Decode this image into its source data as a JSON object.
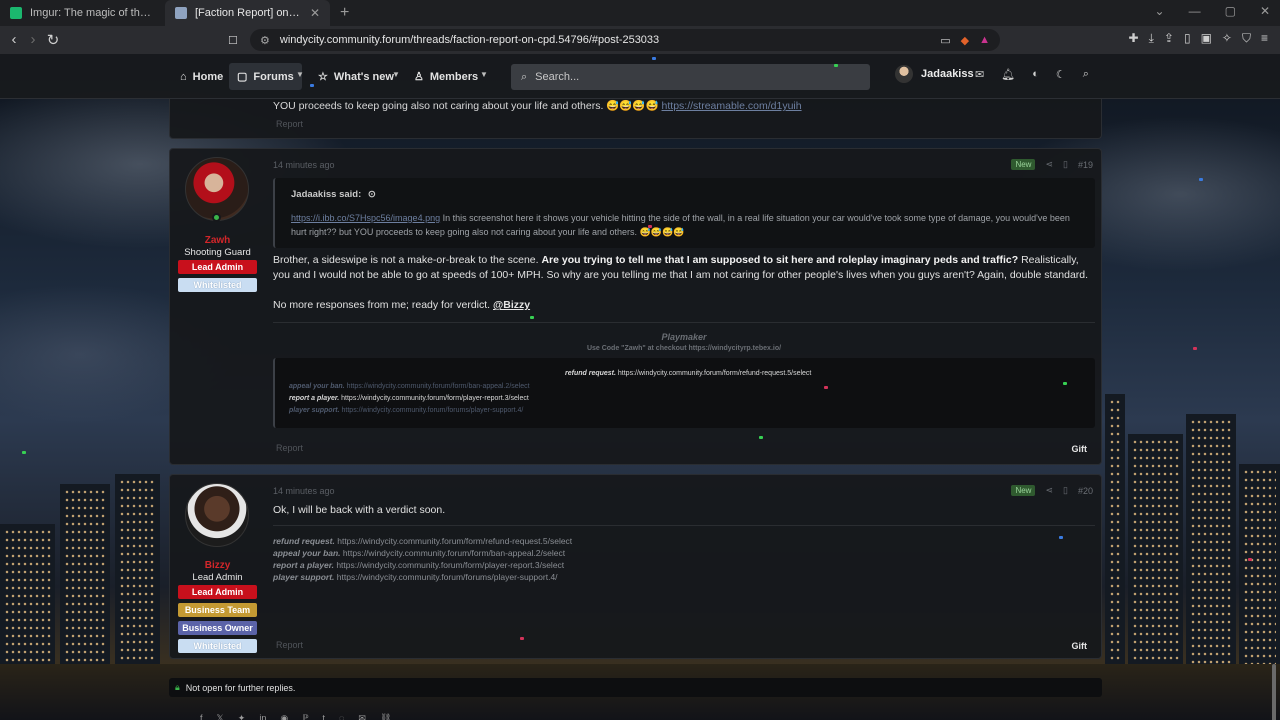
{
  "browser": {
    "tabs": [
      {
        "title": "Imgur: The magic of the Internet",
        "active": false,
        "favicon_color": "#1bb76e"
      },
      {
        "title": "[Faction Report] on CPD | Windy",
        "active": true,
        "favicon_color": "#8fa3c0"
      }
    ],
    "new_tab": "+",
    "url": "windycity.community.forum/threads/faction-report-on-cpd.54796/#post-253033"
  },
  "forum_nav": {
    "home": "Home",
    "forums": "Forums",
    "whats_new": "What's new",
    "members": "Members",
    "search_placeholder": "Search...",
    "username": "Jadaakiss"
  },
  "previous_post": {
    "text_tail": "YOU proceeds to keep going also not caring about your life and others. 😅😅😅😅",
    "link": "https://streamable.com/d1yuih",
    "report": "Report"
  },
  "post_zawh": {
    "time": "14 minutes ago",
    "new": "New",
    "number": "#19",
    "user": {
      "name": "Zawh",
      "title": "Shooting Guard",
      "badges": [
        "Lead Admin",
        "Whitelisted"
      ]
    },
    "quote": {
      "author": "Jadaakiss said:",
      "link": "https://i.ibb.co/S7Hspc56/image4.png",
      "text": " In this screenshot here it shows your vehicle hitting the side of the wall, in a real life situation your car would've took some type of damage, you would've been hurt right?? but YOU proceeds to keep going also not caring about your life and others. 😅😅😅😅"
    },
    "body1_start": "Brother, a sideswipe is not a make-or-break to the scene. ",
    "body1_bold": "Are you trying to tell me that I am supposed to sit here and roleplay imaginary peds and traffic?",
    "body1_end": " Realistically, you and I would not be able to go at speeds of 100+ MPH. So why are you telling me that I am not caring for other people's lives when you guys aren't? Again, double standard.",
    "body2": "No more responses from me; ready for verdict. ",
    "mention": "@Bizzy",
    "signature": {
      "title": "Playmaker",
      "sub": "Use Code \"Zawh\" at checkout https://windycityrp.tebex.io/",
      "refund_label": "refund request.",
      "refund_url": " https://windycity.community.forum/form/refund-request.5/select",
      "appeal_label": "appeal your ban.",
      "appeal_url": " https://windycity.community.forum/form/ban-appeal.2/select",
      "report_label": "report a player.",
      "report_url": " https://windycity.community.forum/form/player-report.3/select",
      "support_label": "player support.",
      "support_url": " https://windycity.community.forum/forums/player-support.4/"
    },
    "report": "Report",
    "gift": "Gift"
  },
  "post_bizzy": {
    "time": "14 minutes ago",
    "new": "New",
    "number": "#20",
    "user": {
      "name": "Bizzy",
      "title": "Lead Admin",
      "badges": [
        "Lead Admin",
        "Business Team",
        "Business Owner",
        "Whitelisted"
      ]
    },
    "body": "Ok, I will be back with a verdict soon.",
    "signature": {
      "refund_label": "refund request.",
      "refund_url": " https://windycity.community.forum/form/refund-request.5/select",
      "appeal_label": "appeal your ban.",
      "appeal_url": " https://windycity.community.forum/form/ban-appeal.2/select",
      "report_label": "report a player.",
      "report_url": " https://windycity.community.forum/form/player-report.3/select",
      "support_label": "player support.",
      "support_url": " https://windycity.community.forum/forums/player-support.4/"
    },
    "report": "Report",
    "gift": "Gift"
  },
  "thread_status": "Not open for further replies.",
  "colors": {
    "lead_admin": "#c8101c",
    "whitelisted": "#c9ddf2",
    "business_team": "#c49a33",
    "business_owner": "#5b63a8",
    "username_red": "#d3262a"
  }
}
